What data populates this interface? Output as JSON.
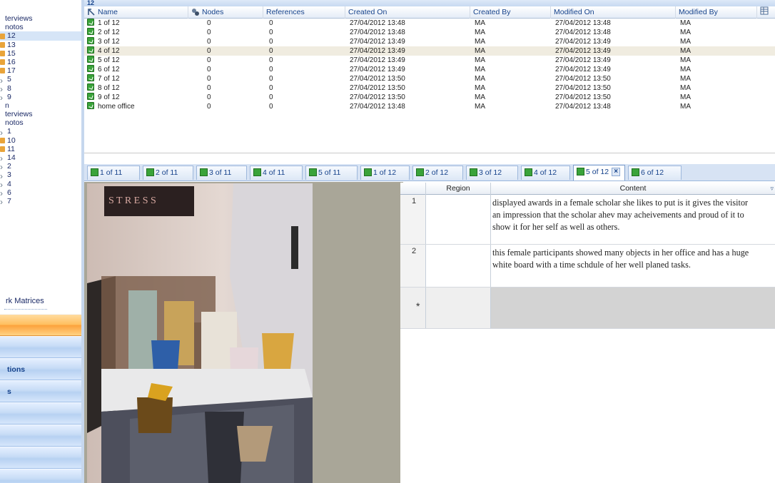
{
  "left_nav": {
    "tree": [
      {
        "label": "terviews",
        "icon": "none"
      },
      {
        "label": "notos",
        "icon": "none"
      },
      {
        "label": "12",
        "icon": "orange-folder-icon",
        "selected": true
      },
      {
        "label": "13",
        "icon": "orange-folder-icon"
      },
      {
        "label": "15",
        "icon": "orange-folder-icon"
      },
      {
        "label": "16",
        "icon": "orange-folder-icon"
      },
      {
        "label": "17",
        "icon": "orange-folder-icon"
      },
      {
        "label": "5",
        "icon": "grey-node-icon"
      },
      {
        "label": "8",
        "icon": "grey-node-icon"
      },
      {
        "label": "9",
        "icon": "grey-node-icon"
      },
      {
        "label": "n",
        "icon": "none"
      },
      {
        "label": "terviews",
        "icon": "none"
      },
      {
        "label": "notos",
        "icon": "none"
      },
      {
        "label": "1",
        "icon": "grey-node-icon"
      },
      {
        "label": "10",
        "icon": "orange-folder-icon"
      },
      {
        "label": "11",
        "icon": "orange-folder-icon"
      },
      {
        "label": "14",
        "icon": "grey-node-icon"
      },
      {
        "label": "2",
        "icon": "grey-node-icon"
      },
      {
        "label": "3",
        "icon": "grey-node-icon"
      },
      {
        "label": "4",
        "icon": "grey-node-icon"
      },
      {
        "label": "6",
        "icon": "grey-node-icon"
      },
      {
        "label": "7",
        "icon": "grey-node-icon"
      }
    ],
    "matrices_label": "rk Matrices",
    "buttons": [
      "",
      "",
      "tions",
      "s",
      "",
      "",
      "",
      ""
    ]
  },
  "top_strip": {
    "title": "12"
  },
  "grid": {
    "columns": [
      "Name",
      "Nodes",
      "References",
      "Created On",
      "Created By",
      "Modified On",
      "Modified By"
    ],
    "rows": [
      {
        "name": "1 of 12",
        "nodes": "0",
        "references": "0",
        "created_on": "27/04/2012 13:48",
        "created_by": "MA",
        "modified_on": "27/04/2012 13:48",
        "modified_by": "MA"
      },
      {
        "name": "2 of 12",
        "nodes": "0",
        "references": "0",
        "created_on": "27/04/2012 13:48",
        "created_by": "MA",
        "modified_on": "27/04/2012 13:48",
        "modified_by": "MA"
      },
      {
        "name": "3 of 12",
        "nodes": "0",
        "references": "0",
        "created_on": "27/04/2012 13:49",
        "created_by": "MA",
        "modified_on": "27/04/2012 13:49",
        "modified_by": "MA"
      },
      {
        "name": "4 of 12",
        "nodes": "0",
        "references": "0",
        "created_on": "27/04/2012 13:49",
        "created_by": "MA",
        "modified_on": "27/04/2012 13:49",
        "modified_by": "MA",
        "selected": true
      },
      {
        "name": "5 of 12",
        "nodes": "0",
        "references": "0",
        "created_on": "27/04/2012 13:49",
        "created_by": "MA",
        "modified_on": "27/04/2012 13:49",
        "modified_by": "MA"
      },
      {
        "name": "6 of 12",
        "nodes": "0",
        "references": "0",
        "created_on": "27/04/2012 13:49",
        "created_by": "MA",
        "modified_on": "27/04/2012 13:49",
        "modified_by": "MA"
      },
      {
        "name": "7 of 12",
        "nodes": "0",
        "references": "0",
        "created_on": "27/04/2012 13:50",
        "created_by": "MA",
        "modified_on": "27/04/2012 13:50",
        "modified_by": "MA"
      },
      {
        "name": "8 of 12",
        "nodes": "0",
        "references": "0",
        "created_on": "27/04/2012 13:50",
        "created_by": "MA",
        "modified_on": "27/04/2012 13:50",
        "modified_by": "MA"
      },
      {
        "name": "9 of 12",
        "nodes": "0",
        "references": "0",
        "created_on": "27/04/2012 13:50",
        "created_by": "MA",
        "modified_on": "27/04/2012 13:50",
        "modified_by": "MA"
      },
      {
        "name": "home office",
        "nodes": "0",
        "references": "0",
        "created_on": "27/04/2012 13:48",
        "created_by": "MA",
        "modified_on": "27/04/2012 13:48",
        "modified_by": "MA"
      }
    ]
  },
  "tabs": [
    {
      "label": "1 of 11"
    },
    {
      "label": "2 of 11"
    },
    {
      "label": "3 of 11"
    },
    {
      "label": "4 of 11"
    },
    {
      "label": "5 of 11"
    },
    {
      "label": "1 of 12"
    },
    {
      "label": "2 of 12"
    },
    {
      "label": "3 of 12"
    },
    {
      "label": "4 of 12"
    },
    {
      "label": "5 of 12",
      "active": true,
      "close": "×"
    },
    {
      "label": "6 of 12"
    }
  ],
  "photo": {
    "poster_text": "S T R E S S"
  },
  "regions": {
    "columns": [
      "Region",
      "Content"
    ],
    "rows": [
      {
        "num": "1",
        "region": "",
        "content_lines": [
          "displayed awards in a female scholar she likes to put is it gives the visitor",
          "an impression that the scholar ahev may acheivements and proud of it to",
          "show it for her self as well as others."
        ]
      },
      {
        "num": "2",
        "region": "",
        "content_lines": [
          "this female participants showed many objects in her office and has a huge",
          "white board with a time schdule of her well planed tasks."
        ]
      }
    ],
    "new_row_marker": "*"
  },
  "colors": {
    "accent": "#15428b",
    "selected_row": "#f0ece0",
    "nav_active": "#fca13a"
  }
}
